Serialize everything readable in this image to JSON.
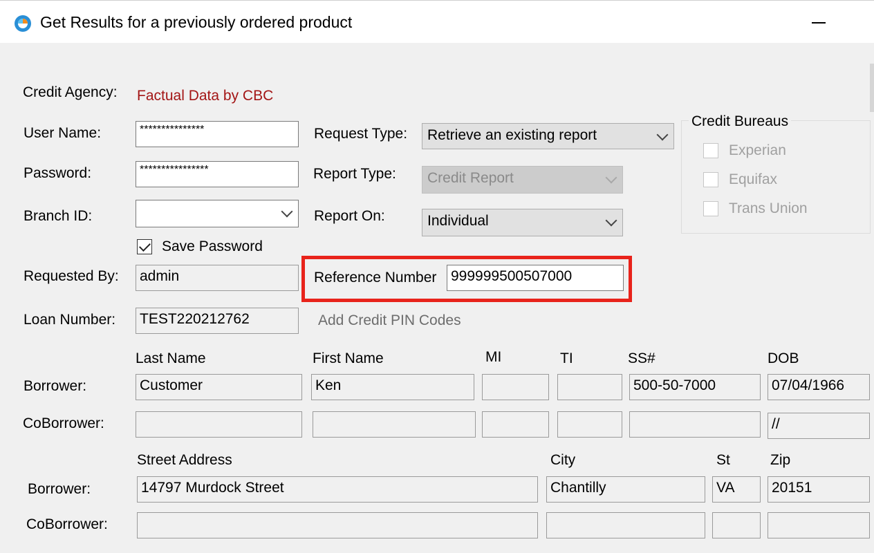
{
  "window": {
    "title": "Get Results for a previously ordered product"
  },
  "form": {
    "credit_agency_label": "Credit Agency:",
    "credit_agency_value": "Factual Data by CBC",
    "user_name_label": "User Name:",
    "user_name_value": "***************",
    "password_label": "Password:",
    "password_value": "****************",
    "branch_id_label": "Branch ID:",
    "branch_id_value": "",
    "save_password_label": "Save Password",
    "save_password_checked": true,
    "requested_by_label": "Requested By:",
    "requested_by_value": "admin",
    "loan_number_label": "Loan Number:",
    "loan_number_value": "TEST220212762",
    "request_type_label": "Request Type:",
    "request_type_value": "Retrieve an existing report",
    "report_type_label": "Report Type:",
    "report_type_value": "Credit Report",
    "report_on_label": "Report On:",
    "report_on_value": "Individual",
    "reference_number_label": "Reference Number",
    "reference_number_value": "999999500507000",
    "add_pin_codes_label": "Add Credit PIN Codes"
  },
  "bureaus": {
    "title": "Credit Bureaus",
    "items": [
      "Experian",
      "Equifax",
      "Trans Union"
    ]
  },
  "people": {
    "headers": {
      "last_name": "Last Name",
      "first_name": "First Name",
      "mi": "MI",
      "ti": "TI",
      "ssn": "SS#",
      "dob": "DOB"
    },
    "borrower_label": "Borrower:",
    "coborrower_label": "CoBorrower:",
    "borrower": {
      "last_name": "Customer",
      "first_name": "Ken",
      "mi": "",
      "ti": "",
      "ssn": "500-50-7000",
      "dob": "07/04/1966"
    },
    "coborrower": {
      "last_name": "",
      "first_name": "",
      "mi": "",
      "ti": "",
      "ssn": "",
      "dob": "//"
    }
  },
  "address": {
    "headers": {
      "street": "Street Address",
      "city": "City",
      "state": "St",
      "zip": "Zip"
    },
    "borrower_label": "Borrower:",
    "coborrower_label": "CoBorrower:",
    "borrower": {
      "street": "14797 Murdock Street",
      "city": "Chantilly",
      "state": "VA",
      "zip": "20151"
    },
    "coborrower": {
      "street": "",
      "city": "",
      "state": "",
      "zip": ""
    }
  }
}
